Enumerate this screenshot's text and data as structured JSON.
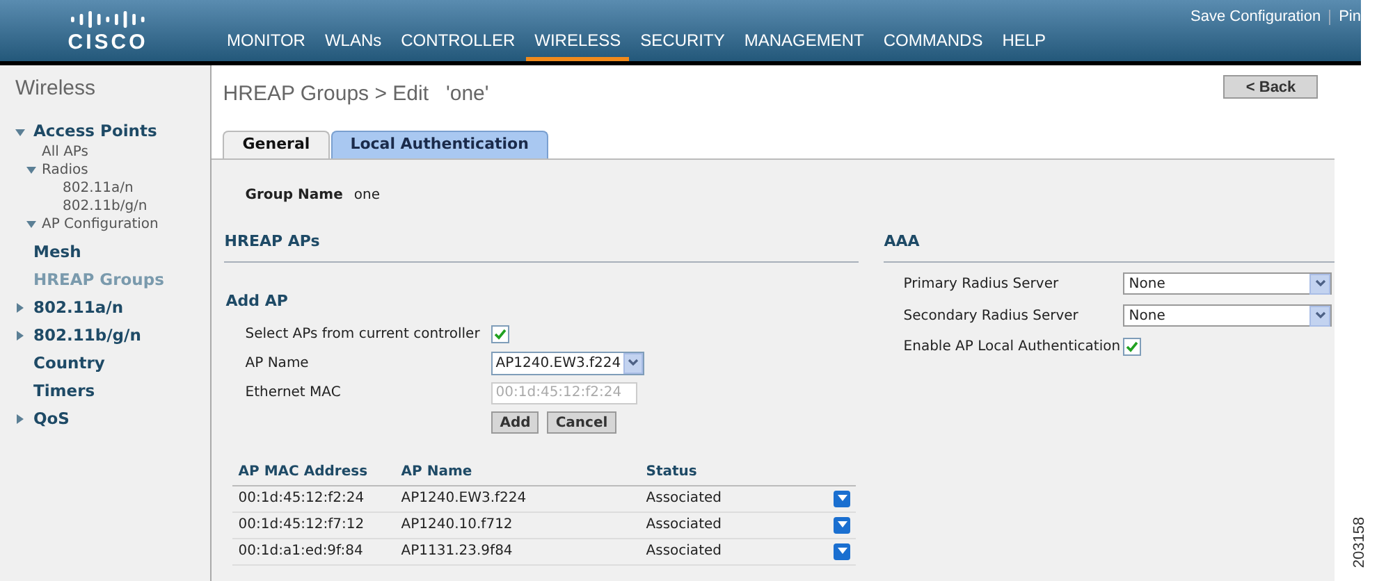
{
  "header": {
    "logo": "CISCO",
    "links": [
      "Save Configuration",
      "Pin"
    ],
    "nav": [
      {
        "label": "MONITOR",
        "selected": false
      },
      {
        "label": "WLANs",
        "selected": false
      },
      {
        "label": "CONTROLLER",
        "selected": false
      },
      {
        "label": "WIRELESS",
        "selected": true
      },
      {
        "label": "SECURITY",
        "selected": false
      },
      {
        "label": "MANAGEMENT",
        "selected": false
      },
      {
        "label": "COMMANDS",
        "selected": false
      },
      {
        "label": "HELP",
        "selected": false
      }
    ]
  },
  "sidebar": {
    "title": "Wireless",
    "items": [
      {
        "label": "Access Points",
        "expanded": true,
        "selected": false,
        "children": [
          {
            "label": "All APs"
          },
          {
            "label": "Radios",
            "expanded": true,
            "children": [
              {
                "label": "802.11a/n"
              },
              {
                "label": "802.11b/g/n"
              }
            ]
          },
          {
            "label": "AP Configuration",
            "expanded": true
          }
        ]
      },
      {
        "label": "Mesh",
        "selected": false
      },
      {
        "label": "HREAP Groups",
        "selected": true
      },
      {
        "label": "802.11a/n",
        "expanded": false,
        "selected": false
      },
      {
        "label": "802.11b/g/n",
        "expanded": false,
        "selected": false
      },
      {
        "label": "Country",
        "selected": false
      },
      {
        "label": "Timers",
        "selected": false
      },
      {
        "label": "QoS",
        "expanded": false,
        "selected": false
      }
    ]
  },
  "page": {
    "title": "HREAP Groups > Edit   'one'",
    "back_button": "< Back",
    "tabs": [
      {
        "label": "General",
        "selected": true
      },
      {
        "label": "Local Authentication",
        "selected": false
      }
    ],
    "group_name": {
      "label": "Group Name",
      "value": "one"
    },
    "hreap_aps": {
      "title": "HREAP APs",
      "add_title": "Add AP",
      "select_from_controller": {
        "label": "Select APs from current controller",
        "checked": true
      },
      "ap_name": {
        "label": "AP Name",
        "value": "AP1240.EW3.f224"
      },
      "ethernet_mac": {
        "label": "Ethernet MAC",
        "placeholder": "00:1d:45:12:f2:24"
      },
      "buttons": [
        "Add",
        "Cancel"
      ],
      "table": {
        "columns": [
          "AP MAC Address",
          "AP Name",
          "Status"
        ],
        "rows": [
          [
            "00:1d:45:12:f2:24",
            "AP1240.EW3.f224",
            "Associated"
          ],
          [
            "00:1d:45:12:f7:12",
            "AP1240.10.f712",
            "Associated"
          ],
          [
            "00:1d:a1:ed:9f:84",
            "AP1131.23.9f84",
            "Associated"
          ]
        ]
      }
    },
    "aaa": {
      "title": "AAA",
      "primary": {
        "label": "Primary Radius Server",
        "value": "None"
      },
      "secondary": {
        "label": "Secondary Radius Server",
        "value": "None"
      },
      "local_auth": {
        "label": "Enable AP Local Authentication",
        "checked": true
      }
    }
  },
  "figure_number": "203158"
}
